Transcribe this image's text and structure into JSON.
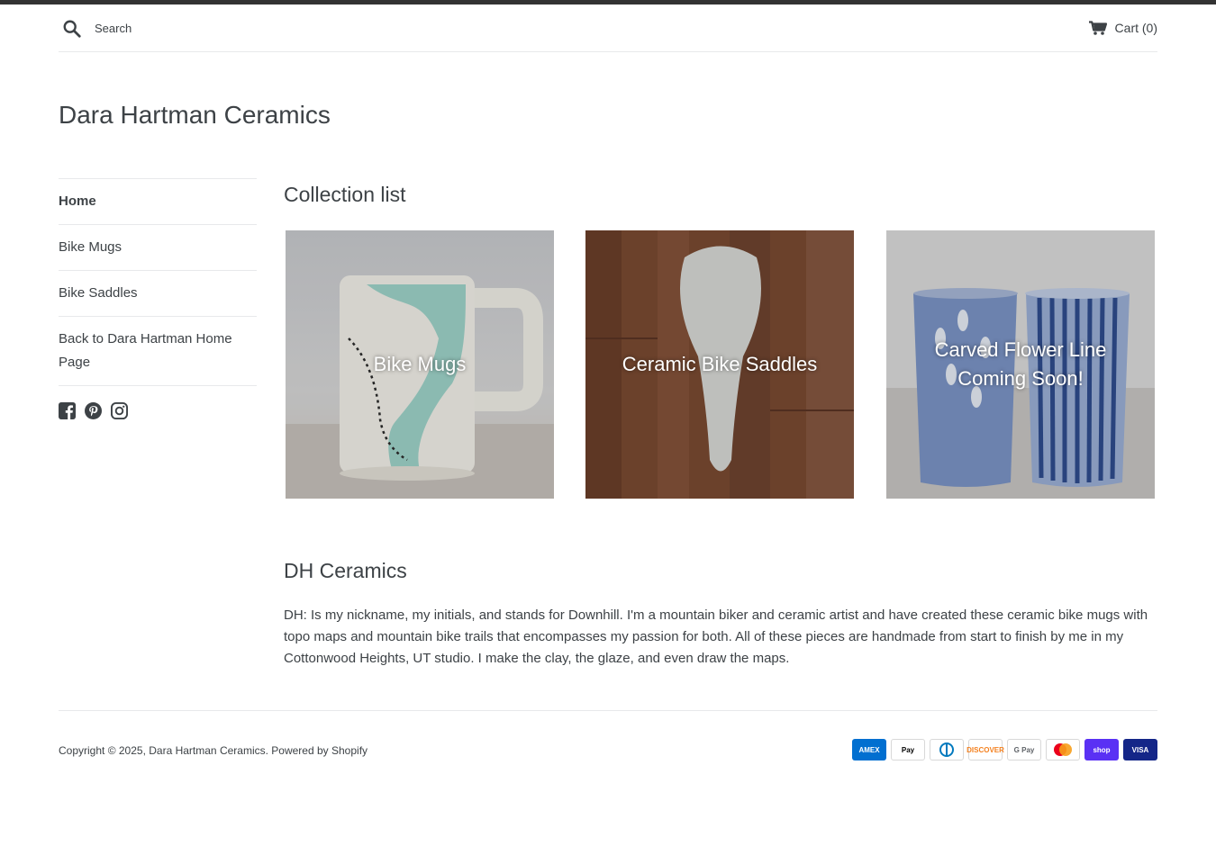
{
  "header": {
    "search_placeholder": "Search",
    "cart_label": "Cart (0)"
  },
  "site": {
    "title": "Dara Hartman Ceramics"
  },
  "sidebar": {
    "items": [
      {
        "label": "Home"
      },
      {
        "label": "Bike Mugs"
      },
      {
        "label": "Bike Saddles"
      },
      {
        "label": "Back to Dara Hartman Home Page"
      }
    ],
    "social_icons": [
      "facebook-icon",
      "pinterest-icon",
      "instagram-icon"
    ]
  },
  "main": {
    "collection_heading": "Collection list",
    "collections": [
      {
        "label": "Bike Mugs"
      },
      {
        "label": "Ceramic Bike Saddles"
      },
      {
        "label": "Carved Flower Line Coming Soon!"
      }
    ],
    "about_heading": "DH Ceramics",
    "about_text": "DH: Is my nickname, my initials, and stands for Downhill. I'm a mountain biker and ceramic artist and have created these ceramic bike mugs with topo maps and mountain bike trails that encompasses my passion for both. All of these pieces are handmade from start to finish by me in my Cottonwood Heights, UT studio. I make the clay, the glaze, and even draw the maps."
  },
  "footer": {
    "copyright_prefix": "Copyright © 2025,",
    "shop_link": "Dara Hartman Ceramics",
    "powered_by": ". Powered by Shopify",
    "payments": [
      {
        "name": "American Express",
        "text": "AMEX",
        "color": "#016fd0"
      },
      {
        "name": "Apple Pay",
        "text": "Pay",
        "color": "#000000"
      },
      {
        "name": "Diners Club",
        "text": "",
        "color": "#0079be"
      },
      {
        "name": "Discover",
        "text": "DISCOVER",
        "color": "#f48120"
      },
      {
        "name": "Google Pay",
        "text": "G Pay",
        "color": "#5f6368"
      },
      {
        "name": "Mastercard",
        "text": "",
        "color": "#eb001b"
      },
      {
        "name": "Shop Pay",
        "text": "shop",
        "color": "#5a31f4"
      },
      {
        "name": "Visa",
        "text": "VISA",
        "color": "#142688"
      }
    ]
  }
}
